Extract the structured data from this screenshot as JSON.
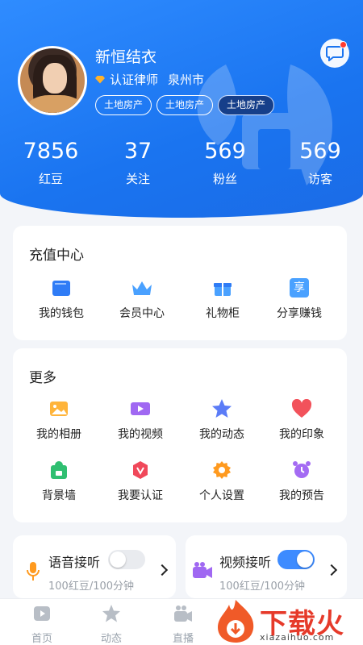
{
  "profile": {
    "name": "新恒结衣",
    "certification": "认证律师",
    "city": "泉州市",
    "tags": [
      "土地房产",
      "土地房产",
      "土地房产"
    ]
  },
  "stats": [
    {
      "value": "7856",
      "label": "红豆"
    },
    {
      "value": "37",
      "label": "关注"
    },
    {
      "value": "569",
      "label": "粉丝"
    },
    {
      "value": "569",
      "label": "访客"
    }
  ],
  "recharge": {
    "title": "充值中心",
    "items": [
      {
        "label": "我的钱包",
        "icon": "wallet-icon"
      },
      {
        "label": "会员中心",
        "icon": "crown-icon"
      },
      {
        "label": "礼物柜",
        "icon": "gift-icon"
      },
      {
        "label": "分享赚钱",
        "icon": "share-icon",
        "glyph": "享"
      }
    ]
  },
  "more": {
    "title": "更多",
    "items": [
      {
        "label": "我的相册",
        "icon": "album-icon"
      },
      {
        "label": "我的视频",
        "icon": "video-icon"
      },
      {
        "label": "我的动态",
        "icon": "star-icon"
      },
      {
        "label": "我的印象",
        "icon": "heart-icon"
      },
      {
        "label": "背景墙",
        "icon": "wallpaper-icon"
      },
      {
        "label": "我要认证",
        "icon": "verify-icon"
      },
      {
        "label": "个人设置",
        "icon": "settings-icon"
      },
      {
        "label": "我的预告",
        "icon": "alarm-icon"
      }
    ]
  },
  "voice": {
    "label": "语音接听",
    "price": "100红豆/100分钟",
    "enabled": false
  },
  "video": {
    "label": "视频接听",
    "price": "100红豆/100分钟",
    "enabled": true
  },
  "tabs": [
    {
      "label": "首页",
      "icon": "home-icon"
    },
    {
      "label": "动态",
      "icon": "moments-icon"
    },
    {
      "label": "直播",
      "icon": "live-icon"
    }
  ],
  "watermark": {
    "text": "下载火",
    "sub": "xiazaihuo.com"
  },
  "colors": {
    "primary": "#1a74f0",
    "toggle_on": "#3d8bff",
    "toggle_off": "#e9ebef"
  }
}
